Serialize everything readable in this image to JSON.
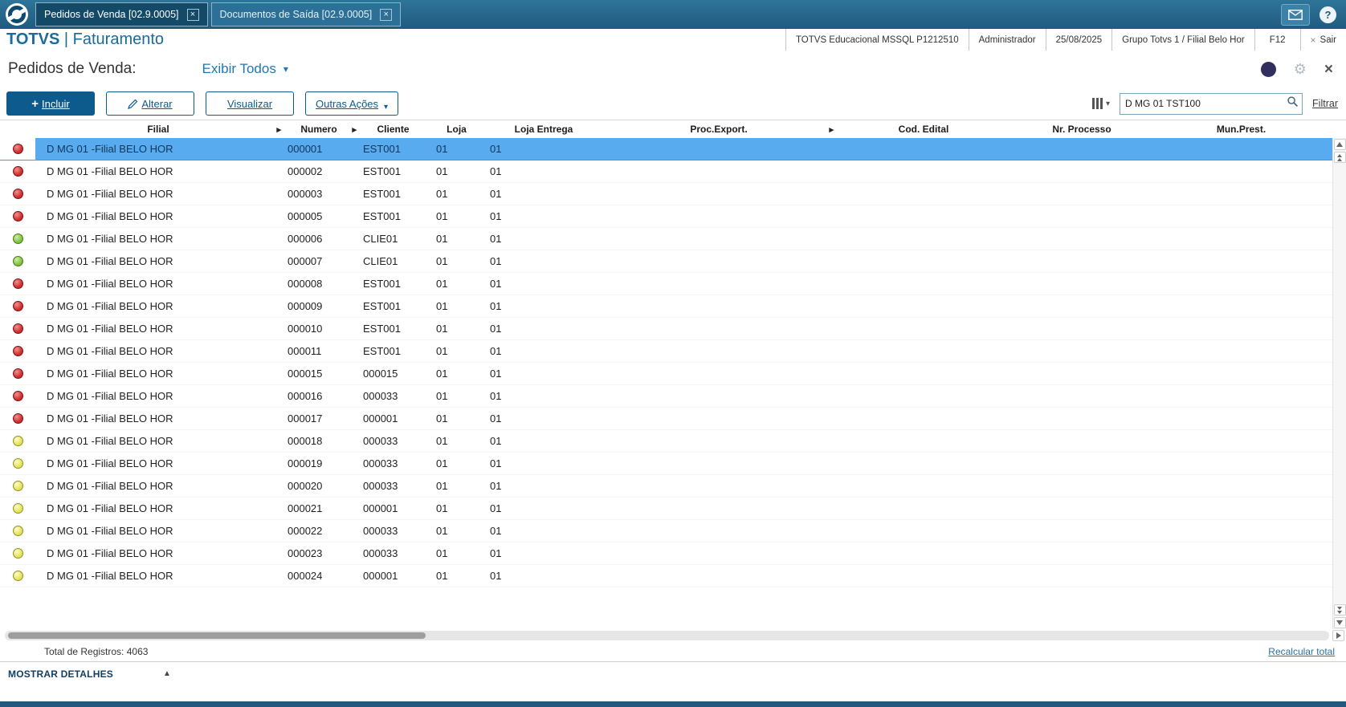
{
  "colors": {
    "topbar": "#245f83",
    "accent": "#0d5a8c",
    "link_blue": "#1e78b4",
    "selected_row": "#58abef",
    "status_red": "#cc2b2b",
    "status_green": "#7dbf3c",
    "status_yellow": "#e3e34f"
  },
  "icons": {
    "close": "×",
    "tab_close": "×",
    "mail": "✉",
    "help": "?",
    "gear": "⚙",
    "caret_down": "▾",
    "expand_right": "▸",
    "plus": "+",
    "pencil": "pencil-svg",
    "search": "magnifier-svg",
    "collapse_up": "▲"
  },
  "tabbar": {
    "tabs": [
      {
        "label": "Pedidos de Venda [02.9.0005]",
        "active": true
      },
      {
        "label": "Documentos de Saída [02.9.0005]",
        "active": false
      }
    ]
  },
  "header": {
    "brand_name": "TOTVS",
    "brand_sep": "|",
    "brand_module": "Faturamento",
    "environment": "TOTVS Educacional MSSQL P1212510",
    "user": "Administrador",
    "date": "25/08/2025",
    "company": "Grupo Totvs 1 / Filial Belo Hor",
    "f12": "F12",
    "exit_label": "Sair"
  },
  "page": {
    "title": "Pedidos de Venda:",
    "view_filter": "Exibir Todos"
  },
  "toolbar": {
    "incluir": "Incluir",
    "alterar": "Alterar",
    "visualizar": "Visualizar",
    "outras_acoes": "Outras Ações",
    "search_value": "D MG 01 TST100",
    "filtrar": "Filtrar"
  },
  "table": {
    "columns": [
      {
        "label": "Filial",
        "arrow": true
      },
      {
        "label": "Numero",
        "arrow": true
      },
      {
        "label": "Cliente",
        "arrow": false
      },
      {
        "label": "Loja",
        "arrow": false
      },
      {
        "label": "Loja Entrega",
        "arrow": false
      },
      {
        "label": "Proc.Export.",
        "arrow": true
      },
      {
        "label": "Cod. Edital",
        "arrow": false
      },
      {
        "label": "Nr. Processo",
        "arrow": false
      },
      {
        "label": "Mun.Prest.",
        "arrow": false
      }
    ],
    "rows": [
      {
        "status": "red",
        "selected": true,
        "filial": "D MG 01 -Filial BELO HOR",
        "numero": "000001",
        "cliente": "EST001",
        "loja": "01",
        "loja_entrega": "01"
      },
      {
        "status": "red",
        "selected": false,
        "filial": "D MG 01 -Filial BELO HOR",
        "numero": "000002",
        "cliente": "EST001",
        "loja": "01",
        "loja_entrega": "01"
      },
      {
        "status": "red",
        "selected": false,
        "filial": "D MG 01 -Filial BELO HOR",
        "numero": "000003",
        "cliente": "EST001",
        "loja": "01",
        "loja_entrega": "01"
      },
      {
        "status": "red",
        "selected": false,
        "filial": "D MG 01 -Filial BELO HOR",
        "numero": "000005",
        "cliente": "EST001",
        "loja": "01",
        "loja_entrega": "01"
      },
      {
        "status": "green",
        "selected": false,
        "filial": "D MG 01 -Filial BELO HOR",
        "numero": "000006",
        "cliente": "CLIE01",
        "loja": "01",
        "loja_entrega": "01"
      },
      {
        "status": "green",
        "selected": false,
        "filial": "D MG 01 -Filial BELO HOR",
        "numero": "000007",
        "cliente": "CLIE01",
        "loja": "01",
        "loja_entrega": "01"
      },
      {
        "status": "red",
        "selected": false,
        "filial": "D MG 01 -Filial BELO HOR",
        "numero": "000008",
        "cliente": "EST001",
        "loja": "01",
        "loja_entrega": "01"
      },
      {
        "status": "red",
        "selected": false,
        "filial": "D MG 01 -Filial BELO HOR",
        "numero": "000009",
        "cliente": "EST001",
        "loja": "01",
        "loja_entrega": "01"
      },
      {
        "status": "red",
        "selected": false,
        "filial": "D MG 01 -Filial BELO HOR",
        "numero": "000010",
        "cliente": "EST001",
        "loja": "01",
        "loja_entrega": "01"
      },
      {
        "status": "red",
        "selected": false,
        "filial": "D MG 01 -Filial BELO HOR",
        "numero": "000011",
        "cliente": "EST001",
        "loja": "01",
        "loja_entrega": "01"
      },
      {
        "status": "red",
        "selected": false,
        "filial": "D MG 01 -Filial BELO HOR",
        "numero": "000015",
        "cliente": "000015",
        "loja": "01",
        "loja_entrega": "01"
      },
      {
        "status": "red",
        "selected": false,
        "filial": "D MG 01 -Filial BELO HOR",
        "numero": "000016",
        "cliente": "000033",
        "loja": "01",
        "loja_entrega": "01"
      },
      {
        "status": "red",
        "selected": false,
        "filial": "D MG 01 -Filial BELO HOR",
        "numero": "000017",
        "cliente": "000001",
        "loja": "01",
        "loja_entrega": "01"
      },
      {
        "status": "yellow",
        "selected": false,
        "filial": "D MG 01 -Filial BELO HOR",
        "numero": "000018",
        "cliente": "000033",
        "loja": "01",
        "loja_entrega": "01"
      },
      {
        "status": "yellow",
        "selected": false,
        "filial": "D MG 01 -Filial BELO HOR",
        "numero": "000019",
        "cliente": "000033",
        "loja": "01",
        "loja_entrega": "01"
      },
      {
        "status": "yellow",
        "selected": false,
        "filial": "D MG 01 -Filial BELO HOR",
        "numero": "000020",
        "cliente": "000033",
        "loja": "01",
        "loja_entrega": "01"
      },
      {
        "status": "yellow",
        "selected": false,
        "filial": "D MG 01 -Filial BELO HOR",
        "numero": "000021",
        "cliente": "000001",
        "loja": "01",
        "loja_entrega": "01"
      },
      {
        "status": "yellow",
        "selected": false,
        "filial": "D MG 01 -Filial BELO HOR",
        "numero": "000022",
        "cliente": "000033",
        "loja": "01",
        "loja_entrega": "01"
      },
      {
        "status": "yellow",
        "selected": false,
        "filial": "D MG 01 -Filial BELO HOR",
        "numero": "000023",
        "cliente": "000033",
        "loja": "01",
        "loja_entrega": "01"
      },
      {
        "status": "yellow",
        "selected": false,
        "filial": "D MG 01 -Filial BELO HOR",
        "numero": "000024",
        "cliente": "000001",
        "loja": "01",
        "loja_entrega": "01"
      }
    ]
  },
  "footer": {
    "total_label": "Total de Registros:",
    "total_value": "4063",
    "recalcular": "Recalcular total",
    "mostrar_detalhes": "MOSTRAR DETALHES"
  }
}
